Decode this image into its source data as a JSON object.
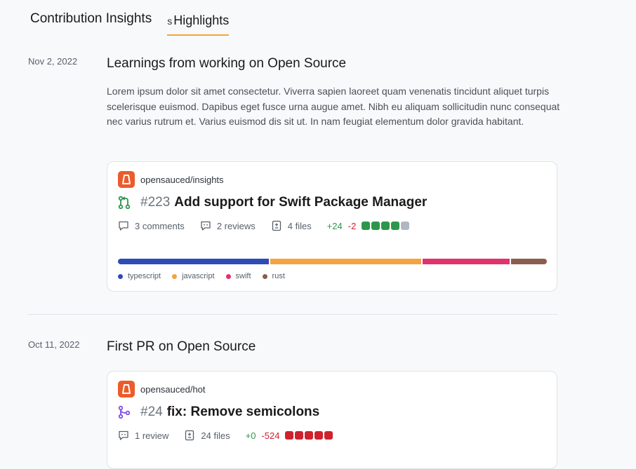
{
  "tabs": {
    "insights_label": "Contribution Insights",
    "highlights_partial": "s",
    "highlights_label": "Highlights"
  },
  "highlights": [
    {
      "date": "Nov 2, 2022",
      "title": "Learnings from working on Open Source",
      "description": "Lorem ipsum dolor sit amet consectetur. Viverra sapien laoreet quam venenatis tincidunt aliquet turpis scelerisque euismod. Dapibus eget fusce urna augue amet. Nibh eu aliquam sollicitudin nunc consequat nec varius rutrum et. Varius euismod dis sit ut. In nam feugiat elementum dolor gravida habitant.",
      "card": {
        "repo": "opensauced/insights",
        "pr_icon": "pull-request-open-icon",
        "pr_number": "#223",
        "pr_title": "Add support for Swift Package Manager",
        "comments": "3 comments",
        "reviews": "2 reviews",
        "files": "4 files",
        "additions": "+24",
        "deletions": "-2",
        "diff_squares": [
          "#2c974b",
          "#2c974b",
          "#2c974b",
          "#2c974b",
          "#afb8c1"
        ],
        "languages": [
          {
            "name": "typescript",
            "color": "#2f4bb5",
            "share": 0.355
          },
          {
            "name": "javascript",
            "color": "#f4a340",
            "share": 0.355
          },
          {
            "name": "swift",
            "color": "#e0336e",
            "share": 0.205
          },
          {
            "name": "rust",
            "color": "#8b5d4e",
            "share": 0.085
          }
        ]
      }
    },
    {
      "date": "Oct 11, 2022",
      "title": "First PR on Open Source",
      "card": {
        "repo": "opensauced/hot",
        "pr_icon": "pull-request-merged-icon",
        "pr_number": "#24",
        "pr_title": "fix: Remove semicolons",
        "reviews": "1 review",
        "files": "24 files",
        "additions": "+0",
        "deletions": "-524",
        "diff_squares": [
          "#cf222e",
          "#cf222e",
          "#cf222e",
          "#cf222e",
          "#cf222e"
        ]
      }
    }
  ]
}
